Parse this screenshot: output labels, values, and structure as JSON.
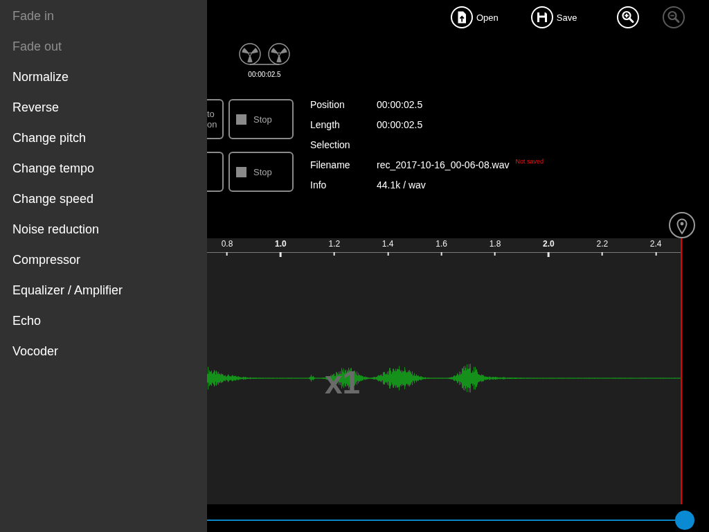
{
  "menu": {
    "items": [
      {
        "label": "Fade in",
        "disabled": true
      },
      {
        "label": "Fade out",
        "disabled": true
      },
      {
        "label": "Normalize",
        "disabled": false
      },
      {
        "label": "Reverse",
        "disabled": false
      },
      {
        "label": "Change pitch",
        "disabled": false
      },
      {
        "label": "Change tempo",
        "disabled": false
      },
      {
        "label": "Change speed",
        "disabled": false
      },
      {
        "label": "Noise reduction",
        "disabled": false
      },
      {
        "label": "Compressor",
        "disabled": false
      },
      {
        "label": "Equalizer / Amplifier",
        "disabled": false
      },
      {
        "label": "Echo",
        "disabled": false
      },
      {
        "label": "Vocoder",
        "disabled": false
      }
    ]
  },
  "toolbar": {
    "buttons": [
      {
        "kind": "open",
        "label": "Open",
        "disabled": false
      },
      {
        "kind": "save",
        "label": "Save",
        "disabled": false
      },
      {
        "kind": "zoom_in",
        "disabled": false
      },
      {
        "kind": "zoom_out",
        "disabled": true
      }
    ]
  },
  "recorder": {
    "time": "00:00:02.5"
  },
  "transport": {
    "rows": [
      {
        "buttons": [
          {
            "kind": "cut",
            "lines": [
              "to",
              "on"
            ]
          },
          {
            "kind": "stop",
            "label": "Stop"
          }
        ]
      },
      {
        "buttons": [
          {
            "kind": "cut"
          },
          {
            "kind": "stop",
            "label": "Stop"
          }
        ]
      }
    ]
  },
  "info": {
    "rows": [
      {
        "label": "Position",
        "value": "00:00:02.5"
      },
      {
        "label": "Length",
        "value": "00:00:02.5"
      },
      {
        "label": "Selection"
      },
      {
        "label": "Filename",
        "value": "rec_2017-10-16_00-06-08.wav",
        "note": "Not saved"
      },
      {
        "label": "Info",
        "value": "44.1k / wav"
      }
    ]
  },
  "timeline": {
    "ticks": [
      {
        "label": "0.8",
        "major": false
      },
      {
        "label": "1.0",
        "major": true
      },
      {
        "label": "1.2",
        "major": false
      },
      {
        "label": "1.4",
        "major": false
      },
      {
        "label": "1.6",
        "major": false
      },
      {
        "label": "1.8",
        "major": false
      },
      {
        "label": "2.0",
        "major": true
      },
      {
        "label": "2.2",
        "major": false
      },
      {
        "label": "2.4",
        "major": false
      }
    ],
    "zoom_label": "x1"
  },
  "slider": {
    "level": 1
  }
}
